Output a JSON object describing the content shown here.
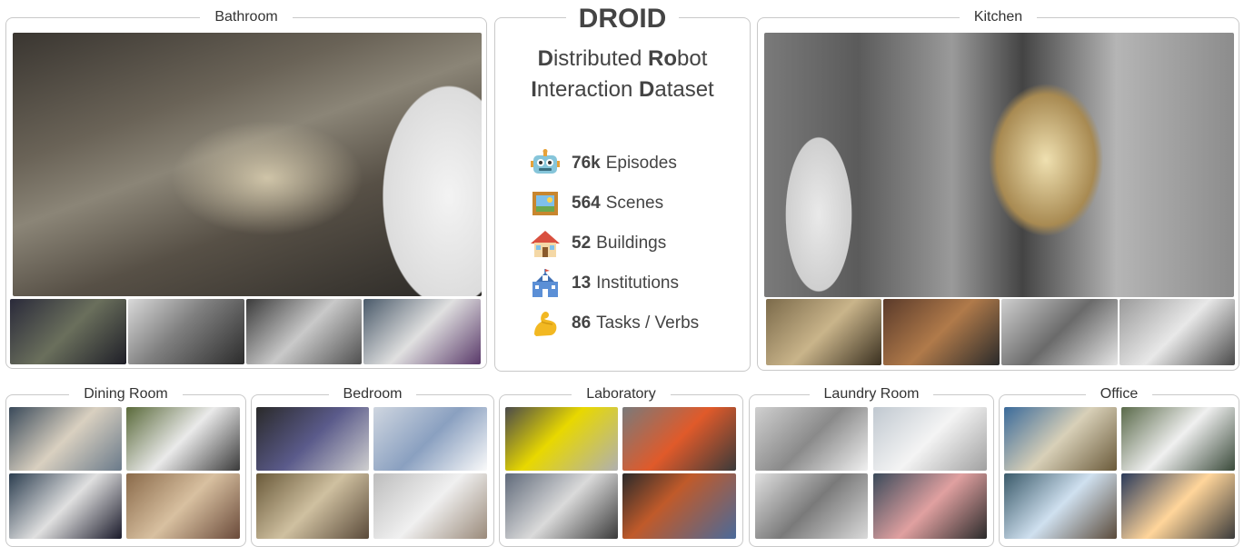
{
  "bathroom": {
    "title": "Bathroom"
  },
  "kitchen": {
    "title": "Kitchen"
  },
  "droid": {
    "title": "DROID",
    "subtitle_line1": [
      {
        "text": "D",
        "bold": true
      },
      {
        "text": "istributed ",
        "bold": false
      },
      {
        "text": "Ro",
        "bold": true
      },
      {
        "text": "bot",
        "bold": false
      }
    ],
    "subtitle_line2": [
      {
        "text": "I",
        "bold": true
      },
      {
        "text": "nteraction ",
        "bold": false
      },
      {
        "text": "D",
        "bold": true
      },
      {
        "text": "ataset",
        "bold": false
      }
    ],
    "stats": [
      {
        "icon": "robot-icon",
        "value": "76k",
        "label": "Episodes"
      },
      {
        "icon": "framed-picture-icon",
        "value": "564",
        "label": "Scenes"
      },
      {
        "icon": "house-icon",
        "value": "52",
        "label": "Buildings"
      },
      {
        "icon": "school-building-icon",
        "value": "13",
        "label": "Institutions"
      },
      {
        "icon": "flexed-biceps-icon",
        "value": "86",
        "label": "Tasks / Verbs"
      }
    ]
  },
  "scenes": [
    {
      "title": "Dining Room"
    },
    {
      "title": "Bedroom"
    },
    {
      "title": "Laboratory"
    },
    {
      "title": "Laundry Room"
    },
    {
      "title": "Office"
    }
  ]
}
